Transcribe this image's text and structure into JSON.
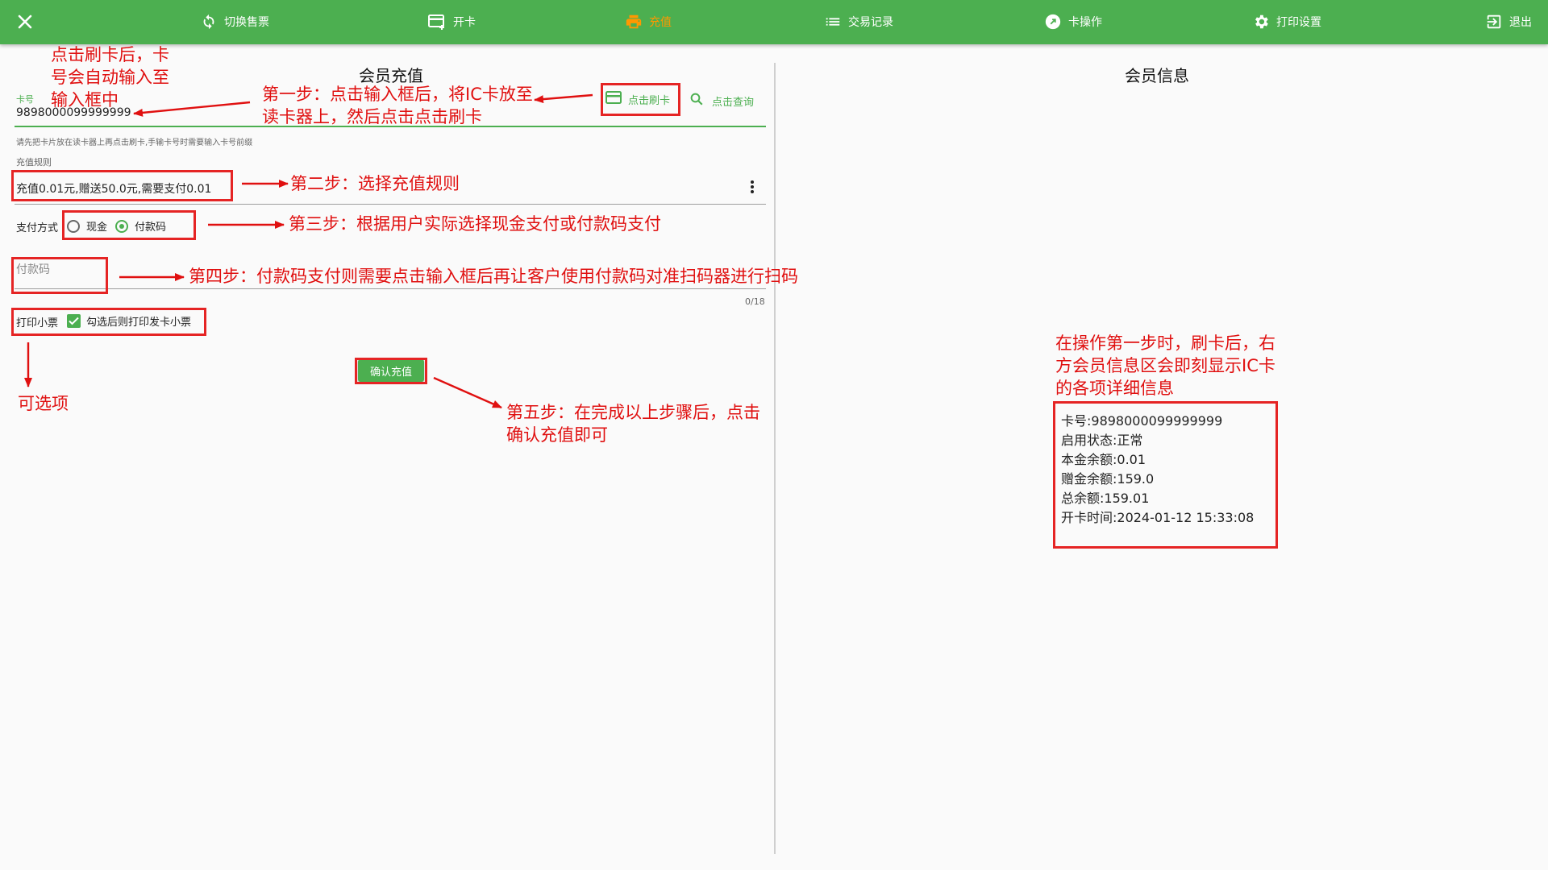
{
  "nav": {
    "switch_ticket": "切换售票",
    "open_card": "开卡",
    "recharge": "充值",
    "records": "交易记录",
    "card_ops": "卡操作",
    "print_settings": "打印设置",
    "logout": "退出"
  },
  "left": {
    "title": "会员充值",
    "card_label": "卡号",
    "card_value": "9898000099999999",
    "swipe_btn": "点击刷卡",
    "query_btn": "点击查询",
    "hint": "请先把卡片放在读卡器上再点击刷卡,手输卡号时需要输入卡号前缀",
    "rule_label": "充值规则",
    "rule_value": "充值0.01元,赠送50.0元,需要支付0.01",
    "pay_label": "支付方式",
    "pay_cash": "现金",
    "pay_code": "付款码",
    "paycode_placeholder": "付款码",
    "counter": "0/18",
    "print_label": "打印小票",
    "print_check_label": "勾选后则打印发卡小票",
    "confirm_btn": "确认充值"
  },
  "right": {
    "title": "会员信息",
    "lines": [
      "卡号:9898000099999999",
      "启用状态:正常",
      "本金余额:0.01",
      "赠金余额:159.0",
      "总余额:159.01",
      "开卡时间:2024-01-12 15:33:08"
    ]
  },
  "annotations": {
    "a_cardauto": [
      "点击刷卡后，卡",
      "号会自动输入至",
      "输入框中"
    ],
    "a_step1": [
      "第一步：点击输入框后，将IC卡放至",
      "读卡器上，然后点击点击刷卡"
    ],
    "a_step2": "第二步：选择充值规则",
    "a_step3": "第三步：根据用户实际选择现金支付或付款码支付",
    "a_step4": "第四步：付款码支付则需要点击输入框后再让客户使用付款码对准扫码器进行扫码",
    "a_optional": "可选项",
    "a_step5": [
      "第五步：在完成以上步骤后，点击",
      "确认充值即可"
    ],
    "a_right": [
      "在操作第一步时，刷卡后，右",
      "方会员信息区会即刻显示IC卡",
      "的各项详细信息"
    ]
  },
  "colors": {
    "primary": "#4caf50",
    "active_nav": "#ff9800",
    "annotation": "#e01010"
  },
  "icons": [
    "close-icon",
    "refresh-icon",
    "add-card-icon",
    "print-icon",
    "list-icon",
    "arrow-circle-icon",
    "gear-icon",
    "logout-icon",
    "credit-card-icon",
    "search-icon",
    "more-vert-icon",
    "check-icon"
  ]
}
